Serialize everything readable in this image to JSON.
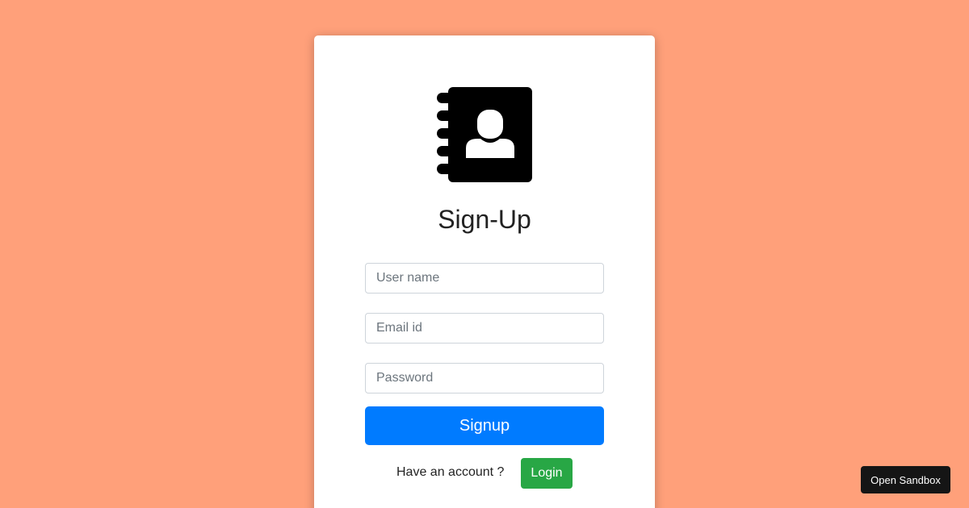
{
  "form": {
    "logo_icon": "address-book-icon",
    "title": "Sign-Up",
    "username_placeholder": "User name",
    "email_placeholder": "Email id",
    "password_placeholder": "Password",
    "signup_label": "Signup",
    "have_account_text": "Have an account ?",
    "login_label": "Login"
  },
  "footer": {
    "open_sandbox_label": "Open Sandbox"
  },
  "colors": {
    "background": "#ffa07a",
    "primary": "#007bff",
    "success": "#28a745",
    "dark_button": "#151515"
  }
}
